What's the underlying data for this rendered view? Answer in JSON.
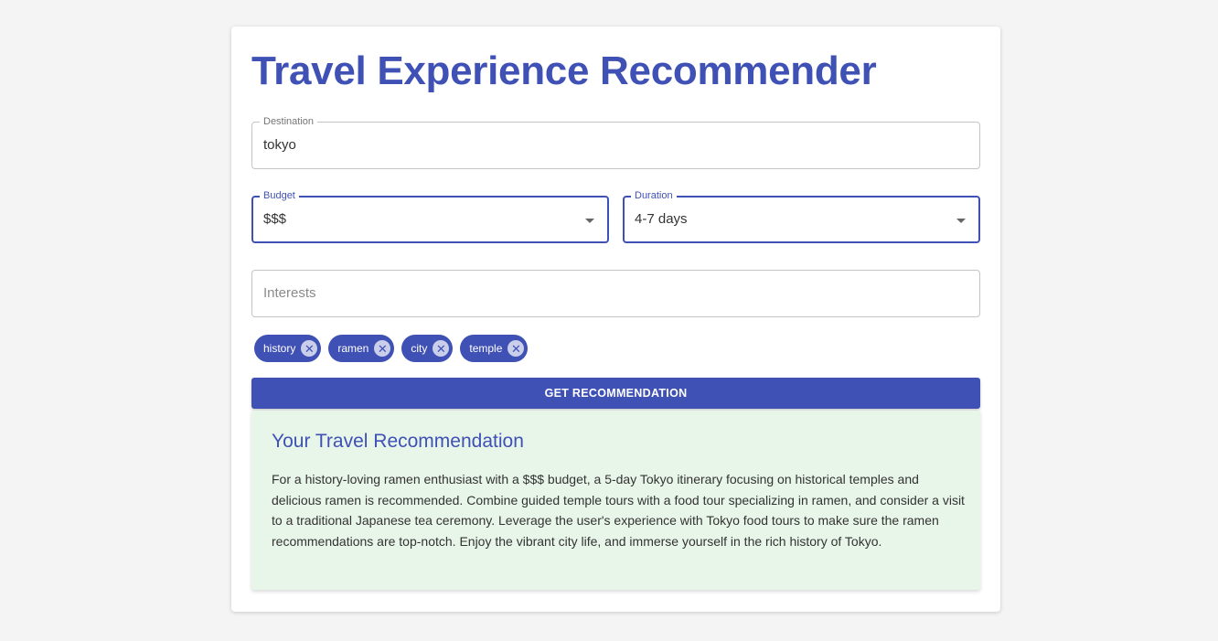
{
  "app": {
    "title": "Travel Experience Recommender"
  },
  "form": {
    "destination": {
      "label": "Destination",
      "value": "tokyo"
    },
    "budget": {
      "label": "Budget",
      "value": "$$$"
    },
    "duration": {
      "label": "Duration",
      "value": "4-7 days"
    },
    "interests": {
      "placeholder": "Interests"
    },
    "chips": [
      {
        "label": "history",
        "remove_icon": "cancel-icon"
      },
      {
        "label": "ramen",
        "remove_icon": "cancel-icon"
      },
      {
        "label": "city",
        "remove_icon": "cancel-icon"
      },
      {
        "label": "temple",
        "remove_icon": "cancel-icon"
      }
    ],
    "submit_label": "GET RECOMMENDATION"
  },
  "result": {
    "heading": "Your Travel Recommendation",
    "body": "For a history-loving ramen enthusiast with a $$$ budget, a 5-day Tokyo itinerary focusing on historical temples and delicious ramen is recommended. Combine guided temple tours with a food tour specializing in ramen, and consider a visit to a traditional Japanese tea ceremony. Leverage the user's experience with Tokyo food tours to make sure the ramen recommendations are top-notch. Enjoy the vibrant city life, and immerse yourself in the rich history of Tokyo."
  },
  "colors": {
    "primary": "#3f51b5",
    "result_background": "#e8f5e9",
    "page_background": "#f4f4f4"
  }
}
